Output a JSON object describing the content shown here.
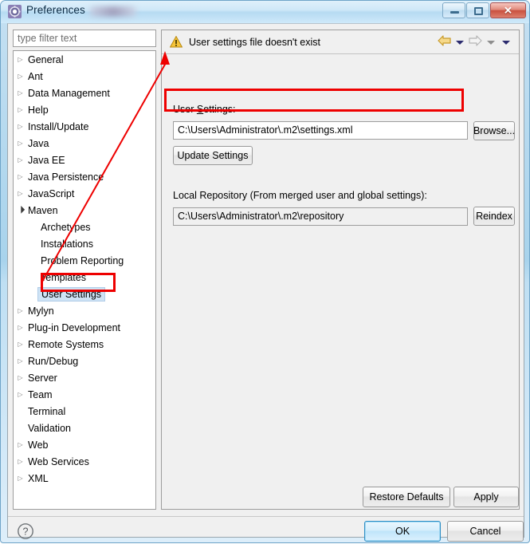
{
  "window": {
    "title": "Preferences",
    "icon": "preferences-gear-icon",
    "buttons": {
      "minimize": "minimize-button",
      "restore": "restore-button",
      "close": "✕"
    }
  },
  "sidebar": {
    "filter": {
      "placeholder": "type filter text",
      "value": ""
    },
    "items": [
      {
        "label": "General",
        "twisty": "collapsed",
        "depth": 0,
        "selected": false
      },
      {
        "label": "Ant",
        "twisty": "collapsed",
        "depth": 0,
        "selected": false
      },
      {
        "label": "Data Management",
        "twisty": "collapsed",
        "depth": 0,
        "selected": false
      },
      {
        "label": "Help",
        "twisty": "collapsed",
        "depth": 0,
        "selected": false
      },
      {
        "label": "Install/Update",
        "twisty": "collapsed",
        "depth": 0,
        "selected": false
      },
      {
        "label": "Java",
        "twisty": "collapsed",
        "depth": 0,
        "selected": false
      },
      {
        "label": "Java EE",
        "twisty": "collapsed",
        "depth": 0,
        "selected": false
      },
      {
        "label": "Java Persistence",
        "twisty": "collapsed",
        "depth": 0,
        "selected": false
      },
      {
        "label": "JavaScript",
        "twisty": "collapsed",
        "depth": 0,
        "selected": false
      },
      {
        "label": "Maven",
        "twisty": "expanded",
        "depth": 0,
        "selected": false
      },
      {
        "label": "Archetypes",
        "twisty": "none",
        "depth": 1,
        "selected": false
      },
      {
        "label": "Installations",
        "twisty": "none",
        "depth": 1,
        "selected": false
      },
      {
        "label": "Problem Reporting",
        "twisty": "none",
        "depth": 1,
        "selected": false
      },
      {
        "label": "Templates",
        "twisty": "none",
        "depth": 1,
        "selected": false
      },
      {
        "label": "User Settings",
        "twisty": "none",
        "depth": 1,
        "selected": true
      },
      {
        "label": "Mylyn",
        "twisty": "collapsed",
        "depth": 0,
        "selected": false
      },
      {
        "label": "Plug-in Development",
        "twisty": "collapsed",
        "depth": 0,
        "selected": false
      },
      {
        "label": "Remote Systems",
        "twisty": "collapsed",
        "depth": 0,
        "selected": false
      },
      {
        "label": "Run/Debug",
        "twisty": "collapsed",
        "depth": 0,
        "selected": false
      },
      {
        "label": "Server",
        "twisty": "collapsed",
        "depth": 0,
        "selected": false
      },
      {
        "label": "Team",
        "twisty": "collapsed",
        "depth": 0,
        "selected": false
      },
      {
        "label": "Terminal",
        "twisty": "none",
        "depth": 0,
        "selected": false
      },
      {
        "label": "Validation",
        "twisty": "none",
        "depth": 0,
        "selected": false
      },
      {
        "label": "Web",
        "twisty": "collapsed",
        "depth": 0,
        "selected": false
      },
      {
        "label": "Web Services",
        "twisty": "collapsed",
        "depth": 0,
        "selected": false
      },
      {
        "label": "XML",
        "twisty": "collapsed",
        "depth": 0,
        "selected": false
      }
    ]
  },
  "page": {
    "header": {
      "status_icon": "warning-icon",
      "status_text": "User settings file doesn't exist",
      "nav": {
        "back": "back-arrow-icon",
        "back_menu": "back-dropdown-caret",
        "forward": "forward-arrow-icon",
        "forward_menu": "forward-dropdown-caret",
        "menu": "view-menu-caret"
      }
    },
    "user_settings": {
      "label_prefix": "User ",
      "label_mnemonic": "S",
      "label_suffix": "ettings:",
      "value": "C:\\Users\\Administrator\\.m2\\settings.xml",
      "browse_label": "Browse...",
      "update_label": "Update Settings"
    },
    "local_repository": {
      "label": "Local Repository (From merged user and global settings):",
      "value": "C:\\Users\\Administrator\\.m2\\repository",
      "reindex_label": "Reindex"
    },
    "restore_defaults_label": "Restore Defaults",
    "apply_label": "Apply"
  },
  "footer": {
    "help_icon": "help-question-icon",
    "ok_label": "OK",
    "cancel_label": "Cancel"
  },
  "annotations": {
    "accent_color": "#ee0000",
    "boxes": [
      {
        "name": "settings-path-highlight"
      },
      {
        "name": "user-settings-tree-highlight"
      }
    ],
    "arrow": {
      "name": "pointer-arrow",
      "from": "User Settings tree node",
      "to": "User Settings path field"
    }
  }
}
